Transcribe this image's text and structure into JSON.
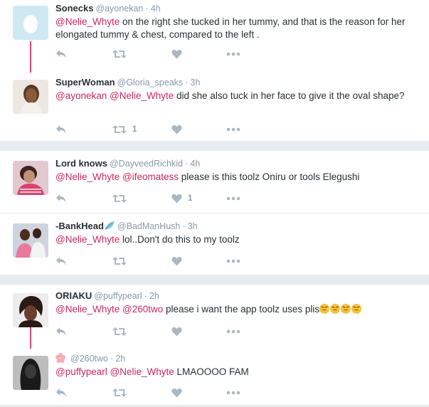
{
  "tweets": [
    {
      "name": "Sonecks",
      "handle": "@ayonekan",
      "time": "4h",
      "text_parts": [
        {
          "t": "@Nelie_Whyte",
          "m": true
        },
        {
          "t": " on the right she tucked in her tummy, and that is the reason for her elongated tummy & chest, compared to  the left .",
          "m": false
        }
      ],
      "retweet_count": "",
      "like_count": ""
    },
    {
      "name": "SuperWoman",
      "handle": "@Gloria_speaks",
      "time": "3h",
      "text_parts": [
        {
          "t": "@ayonekan",
          "m": true
        },
        {
          "t": " ",
          "m": false
        },
        {
          "t": "@Nelie_Whyte",
          "m": true
        },
        {
          "t": " did she also tuck in her face to give it the oval shape?",
          "m": false
        }
      ],
      "retweet_count": "1",
      "like_count": ""
    },
    {
      "name": "Lord knows",
      "handle": "@DayveedRichkid",
      "time": "4h",
      "text_parts": [
        {
          "t": "@Nelie_Whyte",
          "m": true
        },
        {
          "t": " ",
          "m": false
        },
        {
          "t": "@ifeomatess",
          "m": true
        },
        {
          "t": " please is this toolz Oniru or tools Elegushi",
          "m": false
        }
      ],
      "retweet_count": "",
      "like_count": "1"
    },
    {
      "name": "-BankHead",
      "handle": "@BadManHush",
      "time": "3h",
      "text_parts": [
        {
          "t": "@Nelie_Whyte",
          "m": true
        },
        {
          "t": " lol..Don't do this to my toolz",
          "m": false
        }
      ],
      "retweet_count": "",
      "like_count": ""
    },
    {
      "name": "ORIAKU",
      "handle": "@puffypearl",
      "time": "2h",
      "text_parts": [
        {
          "t": "@Nelie_Whyte",
          "m": true
        },
        {
          "t": " ",
          "m": false
        },
        {
          "t": "@260two",
          "m": true
        },
        {
          "t": " please i want the app toolz uses plis",
          "m": false
        }
      ],
      "retweet_count": "",
      "like_count": ""
    },
    {
      "name": "",
      "handle": "@260two",
      "time": "2h",
      "text_parts": [
        {
          "t": "@puffypearl",
          "m": true
        },
        {
          "t": " ",
          "m": false
        },
        {
          "t": "@Nelie_Whyte",
          "m": true
        },
        {
          "t": " LMAOOOO FAM",
          "m": false
        }
      ],
      "retweet_count": "",
      "like_count": ""
    }
  ],
  "separator": "·",
  "icons": {
    "reply": "reply-icon",
    "retweet": "retweet-icon",
    "like": "heart-icon",
    "more": "more-icon"
  },
  "colors": {
    "mention": "#c92862",
    "thread_line": "#d8497a",
    "icon": "#aab8c2",
    "gap": "#e6ecf0"
  }
}
